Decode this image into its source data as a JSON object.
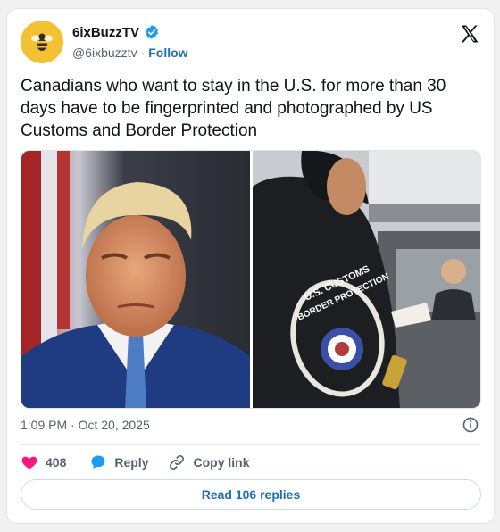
{
  "author": {
    "display_name": "6ixBuzzTV",
    "handle": "@6ixbuzztv",
    "separator": "·",
    "follow_label": "Follow",
    "verified": true,
    "avatar_color": "#f3c233"
  },
  "tweet": {
    "text": "Canadians who want to stay in the U.S. for more than 30 days have to be fingerprinted and photographed by US Customs and Border Protection",
    "timestamp": "1:09 PM · Oct 20, 2025"
  },
  "media": {
    "right_patch": {
      "top_line": "U.S. CUSTOMS",
      "bottom_line": "BORDER PROTECTION"
    }
  },
  "actions": {
    "like_count": "408",
    "reply_label": "Reply",
    "copy_link_label": "Copy link"
  },
  "footer": {
    "read_replies_label": "Read 106 replies"
  },
  "colors": {
    "accent": "#1d6fb3",
    "like": "#f91880",
    "secondary_text": "#536471"
  },
  "icons": [
    "verified-icon",
    "x-logo-icon",
    "info-icon",
    "heart-icon",
    "reply-bubble-icon",
    "link-icon"
  ]
}
